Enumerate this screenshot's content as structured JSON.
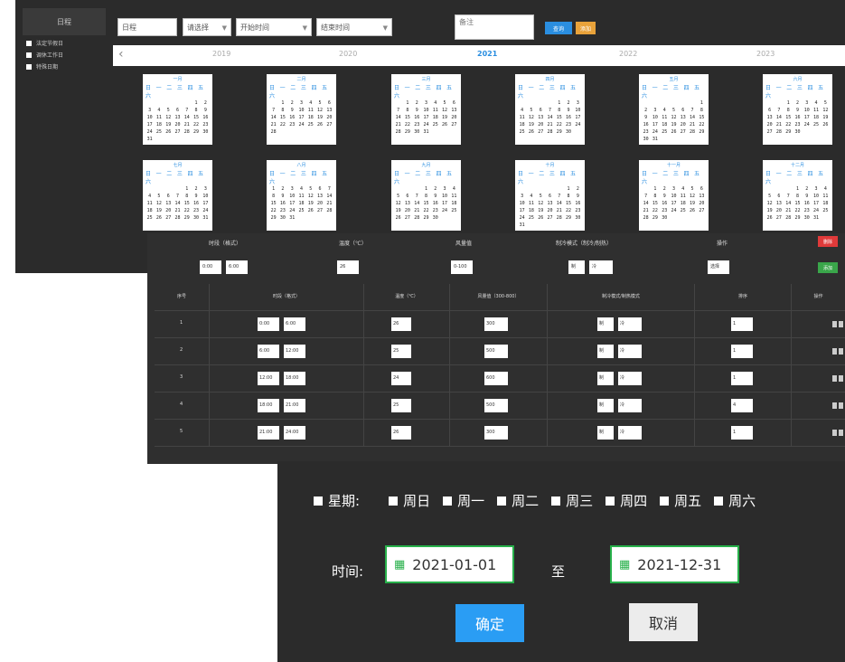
{
  "sidebar": {
    "title": "日程",
    "items": [
      {
        "label": "法定节假日"
      },
      {
        "label": "调休工作日"
      },
      {
        "label": "特殊日期"
      }
    ]
  },
  "toolbar": {
    "select1": "日程",
    "select2": "请选择",
    "select3": "开始时间",
    "select4": "结束时间",
    "search_placeholder": "备注",
    "search_button": "查询",
    "export_button": "添加"
  },
  "yearbar": {
    "years": [
      "2019",
      "2020",
      "2021",
      "2022",
      "2023"
    ],
    "active": "2021"
  },
  "calendar": {
    "weekday_header": "日 一 二 三 四 五 六",
    "months": [
      {
        "name": "一月",
        "start": 5,
        "days": 31
      },
      {
        "name": "二月",
        "start": 1,
        "days": 28
      },
      {
        "name": "三月",
        "start": 1,
        "days": 31
      },
      {
        "name": "四月",
        "start": 4,
        "days": 30
      },
      {
        "name": "五月",
        "start": 6,
        "days": 31
      },
      {
        "name": "六月",
        "start": 2,
        "days": 30
      },
      {
        "name": "七月",
        "start": 4,
        "days": 31
      },
      {
        "name": "八月",
        "start": 0,
        "days": 31
      },
      {
        "name": "九月",
        "start": 3,
        "days": 30
      },
      {
        "name": "十月",
        "start": 5,
        "days": 31
      },
      {
        "name": "十一月",
        "start": 1,
        "days": 30
      },
      {
        "name": "十二月",
        "start": 3,
        "days": 31
      }
    ]
  },
  "slots": {
    "headers": {
      "time": "时段（格式）",
      "temp": "温度（℃）",
      "volume": "风量值",
      "mode": "制冷模式（制冷/制热）",
      "op": "操作"
    },
    "delete_button": "删除",
    "add_button": "添加",
    "template": {
      "start": "0:00",
      "end": "6:00",
      "temp": "26",
      "volume": "0-100",
      "mode_a": "制",
      "mode_b": "冷",
      "op": "选择"
    },
    "columns": [
      "序号",
      "时段（格式）",
      "温度（℃）",
      "风量值（300-800）",
      "制冷模式/制热模式",
      "排序",
      "操作"
    ],
    "rows": [
      {
        "no": "1",
        "start": "0:00",
        "end": "6:00",
        "temp": "26",
        "volume": "300",
        "mode_a": "制",
        "mode_b": "冷",
        "sort": "1"
      },
      {
        "no": "2",
        "start": "6:00",
        "end": "12:00",
        "temp": "25",
        "volume": "500",
        "mode_a": "制",
        "mode_b": "冷",
        "sort": "1"
      },
      {
        "no": "3",
        "start": "12:00",
        "end": "18:00",
        "temp": "24",
        "volume": "600",
        "mode_a": "制",
        "mode_b": "冷",
        "sort": "1"
      },
      {
        "no": "4",
        "start": "18:00",
        "end": "21:00",
        "temp": "25",
        "volume": "500",
        "mode_a": "制",
        "mode_b": "冷",
        "sort": "4"
      },
      {
        "no": "5",
        "start": "21:00",
        "end": "24:00",
        "temp": "26",
        "volume": "300",
        "mode_a": "制",
        "mode_b": "冷",
        "sort": "1"
      }
    ]
  },
  "dialog": {
    "week_label": "星期:",
    "weekdays": [
      "周日",
      "周一",
      "周二",
      "周三",
      "周四",
      "周五",
      "周六"
    ],
    "time_label": "时间:",
    "start_date": "2021-01-01",
    "to_label": "至",
    "end_date": "2021-12-31",
    "ok_button": "确定",
    "cancel_button": "取消"
  },
  "colors": {
    "primary": "#2a9df4",
    "success": "#27b04a",
    "danger": "#e03a3a",
    "warning": "#e8a23a",
    "panel_bg": "#2b2b2b"
  }
}
